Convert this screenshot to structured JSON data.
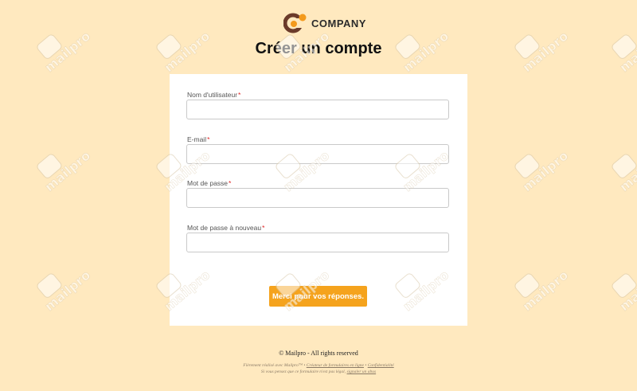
{
  "brand": {
    "name": "COMPANY",
    "colors": {
      "accent": "#f5a31d",
      "logo_dark": "#6b3b2a",
      "logo_orange": "#f39a1c",
      "background": "#ffe9bf",
      "required": "#e02424"
    }
  },
  "page": {
    "title": "Créer un compte"
  },
  "form": {
    "required_marker": "*",
    "fields": [
      {
        "label": "Nom d'utilisateur",
        "value": "",
        "placeholder": ""
      },
      {
        "label": "E-mail",
        "value": "",
        "placeholder": ""
      },
      {
        "label": "Mot de passe",
        "value": "",
        "placeholder": ""
      },
      {
        "label": "Mot de passe à nouveau",
        "value": "",
        "placeholder": ""
      }
    ],
    "submit_label": "Merci pour vos réponses."
  },
  "footer": {
    "copyright": "© Mailpro - All rights reserved",
    "line1": {
      "prefix": "Fièrement réalisé avec Mailpro™ •",
      "link1": "Créateur de formulaires en ligne",
      "separator": "•",
      "link2": "Confidentialité"
    },
    "line2": {
      "prefix": "Si vous pensez que ce formulaire n'est pas légal,",
      "link": "signaler un abus"
    }
  },
  "watermark": {
    "text": "mailpro",
    "icon": "mailpro-envelope-icon"
  }
}
